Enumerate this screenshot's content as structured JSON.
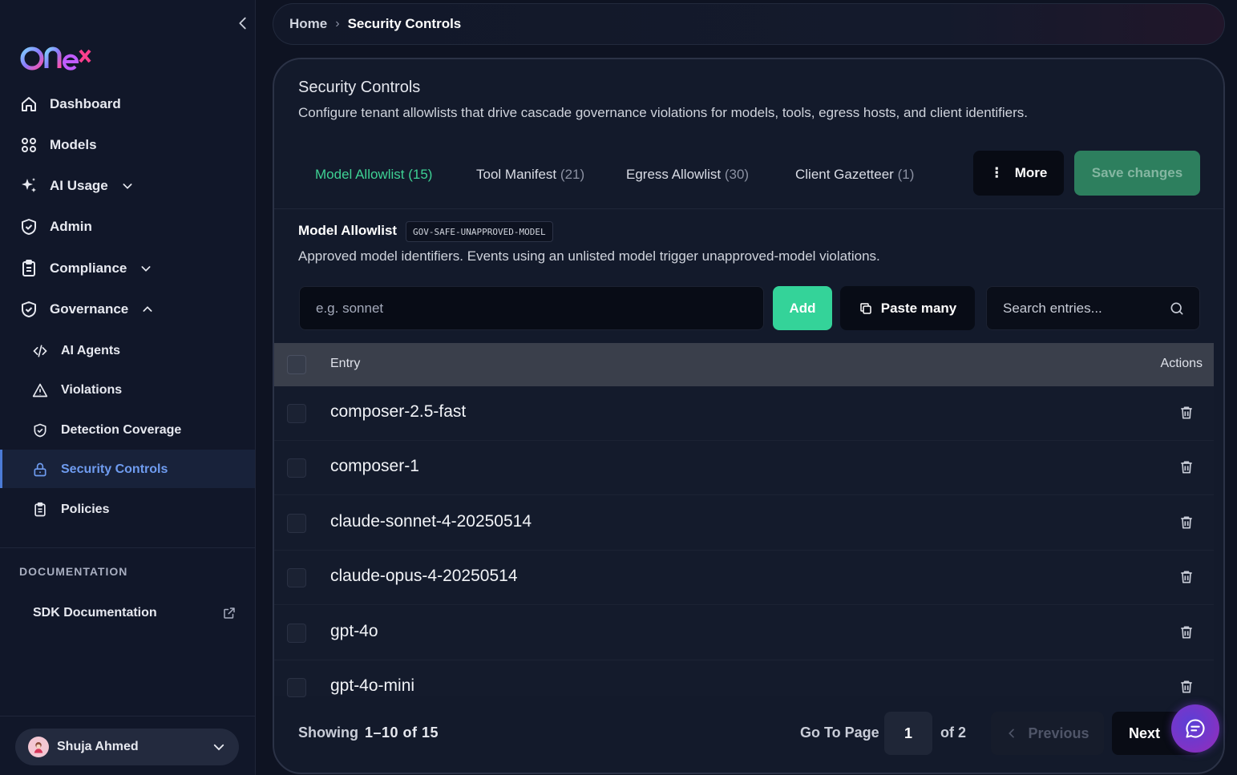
{
  "brand": {
    "logo_text": "Onex"
  },
  "sidebar": {
    "items": [
      {
        "label": "Dashboard",
        "icon": "home-icon"
      },
      {
        "label": "Models",
        "icon": "grid-icon"
      },
      {
        "label": "AI Usage",
        "icon": "sparkle-icon"
      },
      {
        "label": "Admin",
        "icon": "shield-check-icon"
      },
      {
        "label": "Compliance",
        "icon": "clipboard-icon"
      },
      {
        "label": "Governance",
        "icon": "shield-check-icon"
      }
    ],
    "governance_sub": [
      {
        "label": "AI Agents",
        "icon": "code-icon"
      },
      {
        "label": "Violations",
        "icon": "warning-icon"
      },
      {
        "label": "Detection Coverage",
        "icon": "shield-check-icon"
      },
      {
        "label": "Security Controls",
        "icon": "lock-icon",
        "active": true
      },
      {
        "label": "Policies",
        "icon": "clipboard-icon"
      }
    ],
    "documentation_title": "DOCUMENTATION",
    "sdk_label": "SDK Documentation",
    "user_name": "Shuja Ahmed"
  },
  "breadcrumb": {
    "home": "Home",
    "separator": "›",
    "current": "Security Controls"
  },
  "page": {
    "title": "Security Controls",
    "subtitle": "Configure tenant allowlists that drive cascade governance violations for models, tools, egress hosts, and client identifiers.",
    "tabs": [
      {
        "label": "Model Allowlist",
        "count": "(15)",
        "active": true
      },
      {
        "label": "Tool Manifest",
        "count": "(21)"
      },
      {
        "label": "Egress Allowlist",
        "count": "(30)"
      },
      {
        "label": "Client Gazetteer",
        "count": "(1)"
      }
    ],
    "more_label": "More",
    "save_label": "Save changes"
  },
  "section": {
    "title": "Model Allowlist",
    "code": "GOV-SAFE-UNAPPROVED-MODEL",
    "description": "Approved model identifiers. Events using an unlisted model trigger unapproved-model violations.",
    "input_placeholder": "e.g. sonnet",
    "add_label": "Add",
    "paste_label": "Paste many",
    "search_placeholder": "Search entries..."
  },
  "table": {
    "headers": {
      "entry": "Entry",
      "actions": "Actions"
    },
    "rows": [
      "composer-2.5-fast",
      "composer-1",
      "claude-sonnet-4-20250514",
      "claude-opus-4-20250514",
      "gpt-4o",
      "gpt-4o-mini"
    ]
  },
  "pagination": {
    "showing_label": "Showing",
    "range": "1–10 of 15",
    "goto_label": "Go To Page",
    "current_page": "1",
    "of_total": "of 2",
    "previous_label": "Previous",
    "next_label": "Next"
  },
  "colors": {
    "accent_green": "#34d399",
    "active_blue": "#6f9cf0",
    "background": "#0e1322"
  }
}
